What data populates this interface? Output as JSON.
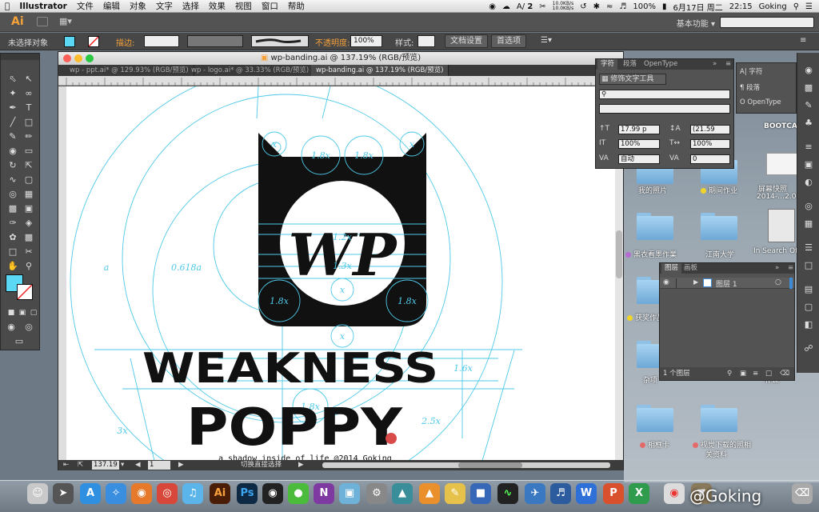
{
  "menubar": {
    "apple": "",
    "app_name": "Illustrator",
    "items": [
      "文件",
      "编辑",
      "对象",
      "文字",
      "选择",
      "效果",
      "视图",
      "窗口",
      "帮助"
    ],
    "input_label": "2",
    "net_up": "10.0KB/s",
    "net_down": "10.0KB/s",
    "battery": "100%",
    "date": "6月17日 周二",
    "time": "22:15",
    "user": "Goking"
  },
  "appbar": {
    "logo": "Ai",
    "workspace": "基本功能"
  },
  "control_bar": {
    "selection": "未选择对象",
    "stroke_label": "描边:",
    "opacity_label": "不透明度:",
    "opacity_value": "100%",
    "style_label": "样式:",
    "doc_setup_button": "文档设置",
    "preferences_button": "首选项"
  },
  "document": {
    "title": "wp-banding.ai @ 137.19% (RGB/预览)",
    "tabs": [
      {
        "label": "wp - ppt.ai* @ 129.93% (RGB/预览)",
        "active": false
      },
      {
        "label": "wp - logo.ai* @ 33.33% (RGB/预览)",
        "active": false
      },
      {
        "label": "wp-banding.ai @ 137.19% (RGB/预览)",
        "active": true
      }
    ],
    "zoom": "137.19",
    "page": "1",
    "status": "切换直接选择"
  },
  "artwork": {
    "brand_line1": "WEAKNESS",
    "brand_line2": "POPPY",
    "logo_letters": "WP",
    "tagline": "a shadow inside of life @2014 Goking",
    "guide_labels": [
      "x",
      "x",
      "1.8x",
      "1.8x",
      "1.2x",
      "1.3x",
      "x",
      "1.8x",
      "1.8x",
      "x",
      "1.6x",
      "1.8x",
      "2.5x",
      "3x",
      "a",
      "0.618a"
    ]
  },
  "character_panel": {
    "tabs": [
      "字符",
      "段落",
      "OpenType"
    ],
    "touch_type_button": "修饰文字工具",
    "font_size": "17.99 p",
    "leading": "(21.59",
    "vertical_scale": "100%",
    "horizontal_scale": "100%",
    "kerning": "自动",
    "tracking": "0"
  },
  "dock_panel": {
    "items": [
      "字符",
      "段落",
      "OpenType"
    ]
  },
  "layers_panel": {
    "tabs": [
      "图层",
      "画板"
    ],
    "layer_name": "图层 1",
    "count": "1 个图层"
  },
  "desktop": {
    "bootcamp": "BOOTCAM",
    "screenshot_label": "屏幕快照",
    "screenshot_date": "2014-…2.0",
    "book_label": "In Search Of",
    "folders": [
      "我的照片",
      "期间作业",
      "黑衣看墨作業",
      "江南大学",
      "获奖作品",
      "杂项",
      "补课",
      "相框卡",
      "视觉下载的照相",
      "关资料"
    ]
  },
  "watermark": "@Goking",
  "colors": {
    "guide": "#4ec9e8",
    "ink": "#111111",
    "accent": "#f7a13a",
    "fill_swatch": "#5ad8f4"
  }
}
